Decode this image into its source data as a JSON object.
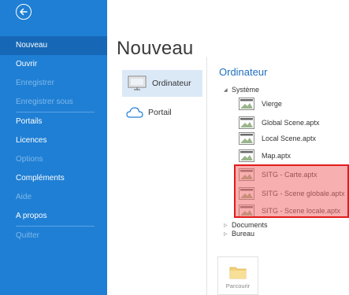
{
  "sidebar": {
    "items": [
      {
        "label": "Nouveau",
        "state": "active"
      },
      {
        "label": "Ouvrir",
        "state": "normal"
      },
      {
        "label": "Enregistrer",
        "state": "disabled"
      },
      {
        "label": "Enregistrer sous",
        "state": "disabled"
      },
      {
        "label": "Portails",
        "state": "normal"
      },
      {
        "label": "Licences",
        "state": "normal"
      },
      {
        "label": "Options",
        "state": "disabled"
      },
      {
        "label": "Compléments",
        "state": "normal"
      },
      {
        "label": "Aide",
        "state": "disabled"
      },
      {
        "label": "A propos",
        "state": "normal"
      },
      {
        "label": "Quitter",
        "state": "disabled"
      }
    ]
  },
  "main": {
    "title": "Nouveau",
    "locations": [
      {
        "label": "Ordinateur",
        "icon": "computer-icon",
        "selected": true
      },
      {
        "label": "Portail",
        "icon": "cloud-icon",
        "selected": false
      }
    ]
  },
  "panel": {
    "title": "Ordinateur",
    "system_group": "Système",
    "files": [
      {
        "name": "Vierge"
      },
      {
        "name": "Global Scene.aptx"
      },
      {
        "name": "Local Scene.aptx"
      },
      {
        "name": "Map.aptx"
      },
      {
        "name": "SITG - Carte.aptx"
      },
      {
        "name": "SITG - Scene globale.aptx"
      },
      {
        "name": "SITG - Scene locale.aptx"
      }
    ],
    "documents_group": "Documents",
    "bureau_group": "Bureau",
    "browse_label": "Parcourir"
  },
  "colors": {
    "sidebar_bg": "#1f7fd4",
    "sidebar_active": "#1668b6",
    "accent": "#1f6fbf",
    "highlight_border": "#e21b1b"
  }
}
